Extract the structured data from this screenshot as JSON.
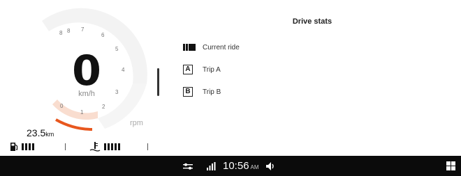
{
  "cluster": {
    "speed_value": "0",
    "speed_unit": "km/h",
    "rpm_label": "rpm",
    "rpm_ticks": [
      "0",
      "1",
      "2",
      "3",
      "4",
      "5",
      "6",
      "7",
      "8",
      "8",
      "8"
    ],
    "odometer_value": "23.5",
    "odometer_unit": "km",
    "fuel_level": "4/4",
    "temp_level": "5/5",
    "accent_color": "#e8571e"
  },
  "panel": {
    "title": "Drive stats",
    "items": [
      {
        "icon": "current-ride-icon",
        "label": "Current ride"
      },
      {
        "icon": "trip-a-icon",
        "badge": "A",
        "label": "Trip A"
      },
      {
        "icon": "trip-b-icon",
        "badge": "B",
        "label": "Trip B"
      }
    ]
  },
  "statusbar": {
    "time": "10:56",
    "ampm": "AM",
    "icons": [
      "settings-sliders-icon",
      "signal-icon",
      "volume-icon",
      "apps-grid-icon"
    ]
  }
}
